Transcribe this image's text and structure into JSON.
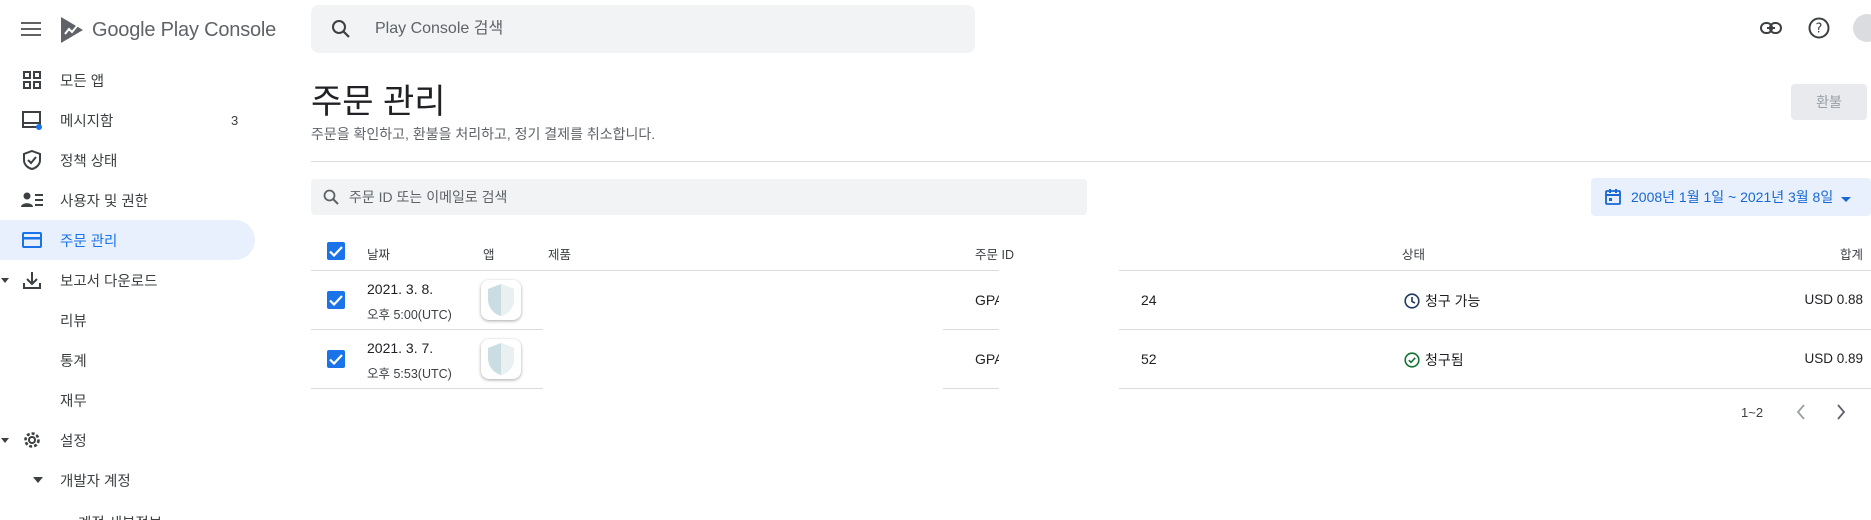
{
  "app": {
    "brand": "Google Play Console"
  },
  "search": {
    "placeholder": "Play Console 검색"
  },
  "sidebar": {
    "items": [
      {
        "label": "모든 앱",
        "icon": "grid-icon"
      },
      {
        "label": "메시지함",
        "icon": "inbox-icon",
        "count": "3"
      },
      {
        "label": "정책 상태",
        "icon": "shield-check-icon"
      },
      {
        "label": "사용자 및 권한",
        "icon": "user-list-icon"
      },
      {
        "label": "주문 관리",
        "icon": "credit-card-icon"
      },
      {
        "label": "보고서 다운로드",
        "icon": "download-icon"
      },
      {
        "label": "리뷰"
      },
      {
        "label": "통계"
      },
      {
        "label": "재무"
      },
      {
        "label": "설정",
        "icon": "gear-icon"
      },
      {
        "label": "개발자 계정"
      },
      {
        "label": "계정 세부정보"
      }
    ]
  },
  "page": {
    "title": "주문 관리",
    "subtitle": "주문을 확인하고, 환불을 처리하고, 정기 결제를 취소합니다.",
    "refund_label": "환불"
  },
  "filter": {
    "placeholder": "주문 ID 또는 이메일로 검색"
  },
  "date_range": "2008년 1월 1일 ~ 2021년 3월 8일",
  "table": {
    "headers": {
      "date": "날짜",
      "app": "앱",
      "product": "제품",
      "order_id": "주문 ID",
      "status": "상태",
      "total": "합계"
    },
    "rows": [
      {
        "date": "2021. 3. 8.",
        "time": "오후 5:00(UTC)",
        "order_prefix": "GPA",
        "order_suffix": "24",
        "status": "청구 가능",
        "status_icon": "clock-icon",
        "total": "USD 0.88"
      },
      {
        "date": "2021. 3. 7.",
        "time": "오후 5:53(UTC)",
        "order_prefix": "GPA",
        "order_suffix": "52",
        "status": "청구됨",
        "status_icon": "check-circle-icon",
        "total": "USD 0.89"
      }
    ]
  },
  "pagination": {
    "range": "1~2"
  }
}
